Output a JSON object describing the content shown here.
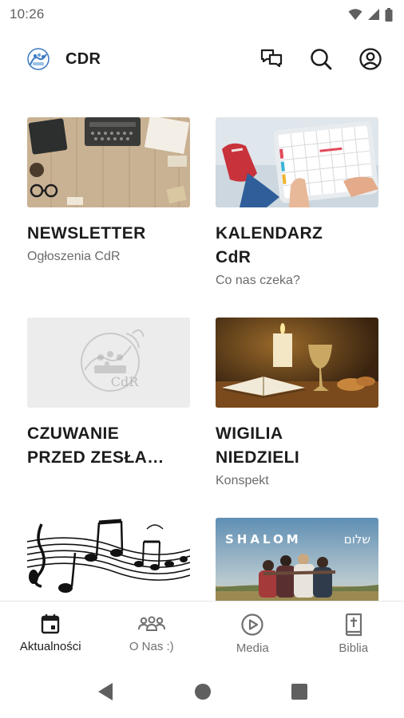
{
  "status": {
    "time": "10:26"
  },
  "app": {
    "title": "CDR"
  },
  "cards": [
    {
      "title": "NEWSLETTER",
      "subtitle": "Ogłoszenia CdR"
    },
    {
      "title": "KALENDARZ\nCdR",
      "subtitle": "Co nas czeka?"
    },
    {
      "title": "CZUWANIE\nPRZED ZESŁA…",
      "subtitle": ""
    },
    {
      "title": "WIGILIA\nNIEDZIELI",
      "subtitle": "Konspekt"
    },
    {
      "title": "",
      "subtitle": ""
    },
    {
      "title": "",
      "subtitle": "",
      "image_text": {
        "latin": "SHALOM",
        "hebrew": "שלום"
      }
    }
  ],
  "placeholder_logo_text": "CdR",
  "bottom_nav": [
    {
      "label": "Aktualności",
      "icon": "calendar-icon",
      "active": true
    },
    {
      "label": "O Nas :)",
      "icon": "group-icon",
      "active": false
    },
    {
      "label": "Media",
      "icon": "play-icon",
      "active": false
    },
    {
      "label": "Biblia",
      "icon": "bible-icon",
      "active": false
    }
  ],
  "colors": {
    "text": "#1c1c1c",
    "muted": "#6b6b6b",
    "nav_inactive": "#707070",
    "placeholder_bg": "#ececec"
  }
}
